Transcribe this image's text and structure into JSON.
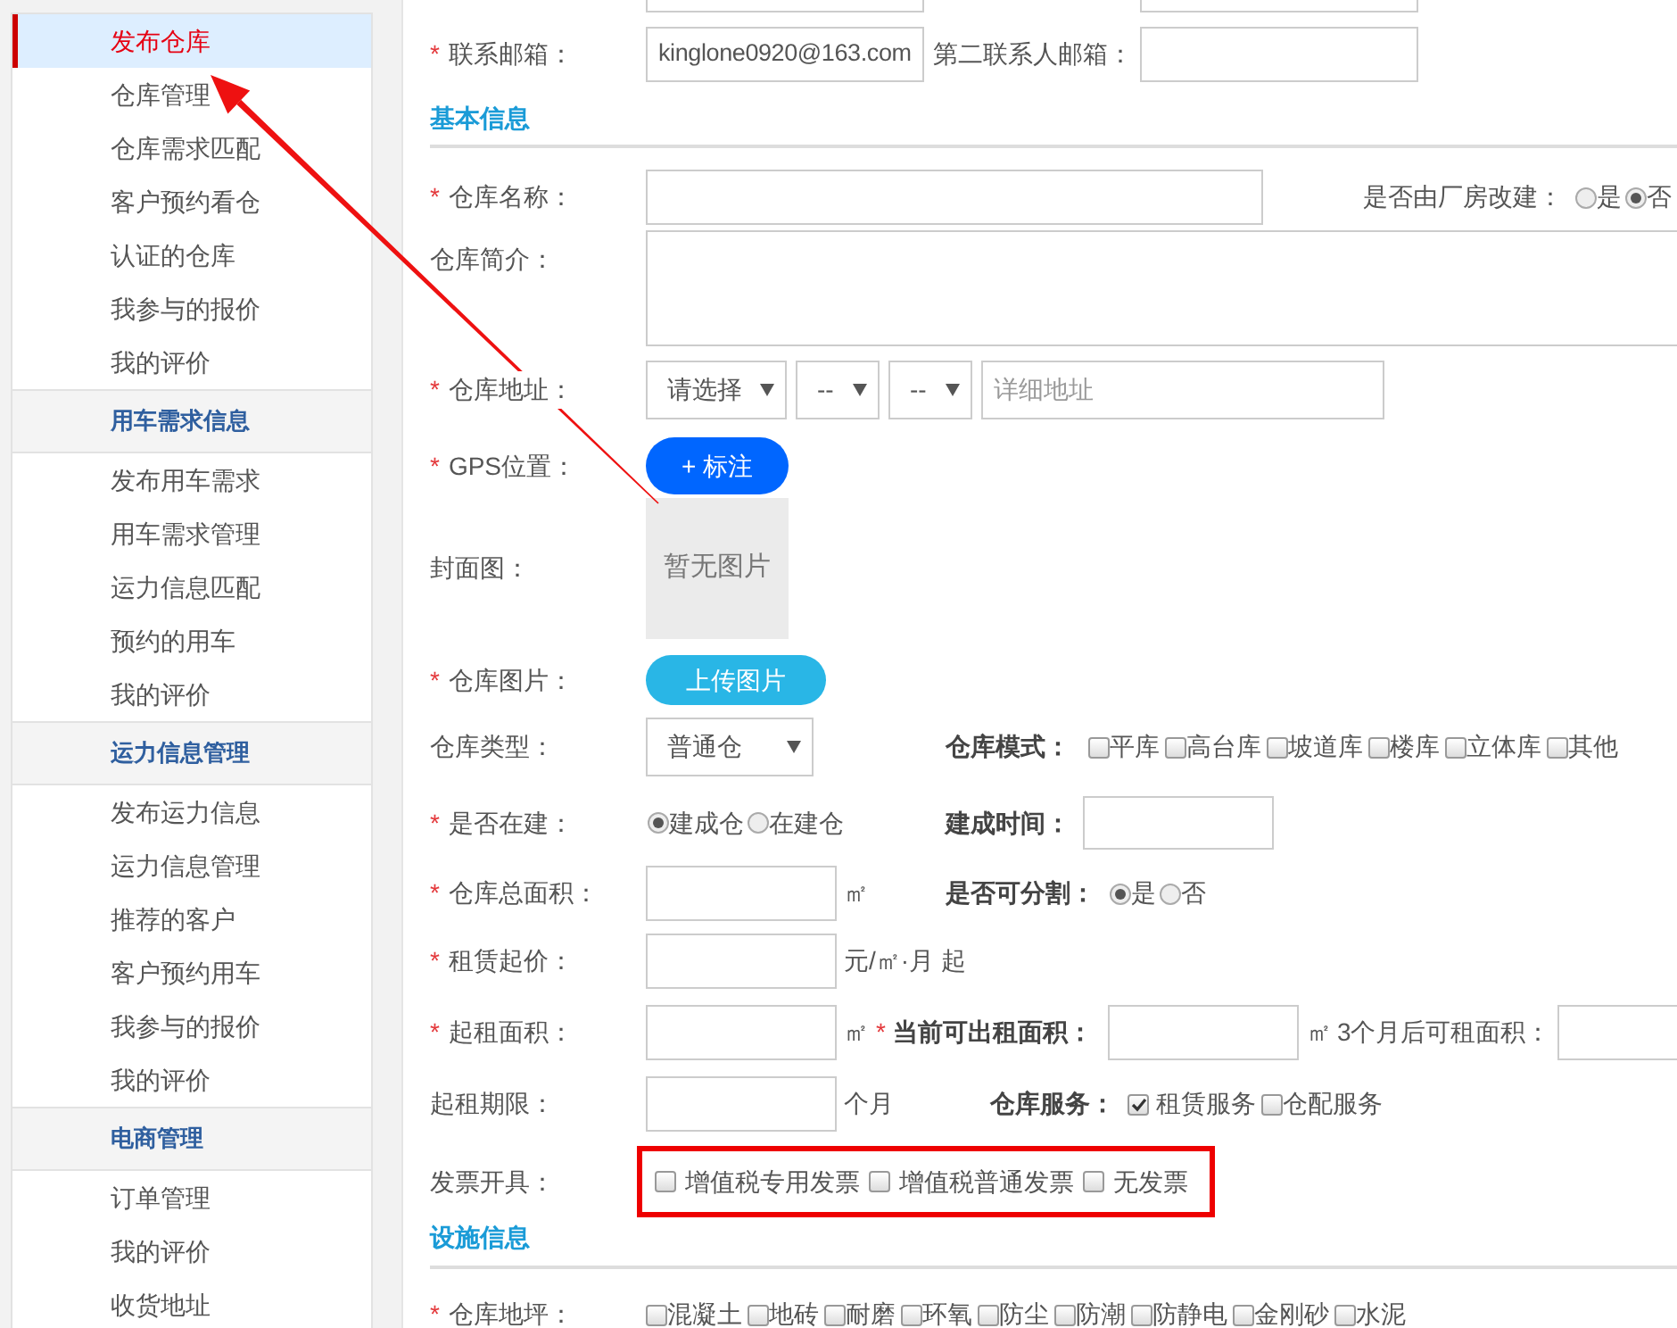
{
  "sidebar": {
    "sections": [
      {
        "items": [
          {
            "label": "发布仓库",
            "selected": true
          },
          {
            "label": "仓库管理",
            "selected": false
          },
          {
            "label": "仓库需求匹配",
            "selected": false
          },
          {
            "label": "客户预约看仓",
            "selected": false
          },
          {
            "label": "认证的仓库",
            "selected": false
          },
          {
            "label": "我参与的报价",
            "selected": false
          },
          {
            "label": "我的评价",
            "selected": false
          }
        ]
      },
      {
        "title": "用车需求信息",
        "items": [
          {
            "label": "发布用车需求",
            "selected": false
          },
          {
            "label": "用车需求管理",
            "selected": false
          },
          {
            "label": "运力信息匹配",
            "selected": false
          },
          {
            "label": "预约的用车",
            "selected": false
          },
          {
            "label": "我的评价",
            "selected": false
          }
        ]
      },
      {
        "title": "运力信息管理",
        "items": [
          {
            "label": "发布运力信息",
            "selected": false
          },
          {
            "label": "运力信息管理",
            "selected": false
          },
          {
            "label": "推荐的客户",
            "selected": false
          },
          {
            "label": "客户预约用车",
            "selected": false
          },
          {
            "label": "我参与的报价",
            "selected": false
          },
          {
            "label": "我的评价",
            "selected": false
          }
        ]
      },
      {
        "title": "电商管理",
        "items": [
          {
            "label": "订单管理",
            "selected": false
          },
          {
            "label": "我的评价",
            "selected": false
          },
          {
            "label": "收货地址",
            "selected": false
          }
        ]
      }
    ]
  },
  "form": {
    "email": {
      "mark": "*",
      "label": "联系邮箱：",
      "value": "kinglone0920@163.com"
    },
    "second_email": {
      "label": "第二联系人邮箱："
    },
    "basic_section": "基本信息",
    "warehouse_name": {
      "mark": "*",
      "label": "仓库名称："
    },
    "converted": {
      "label": "是否由厂房改建：",
      "options": [
        {
          "label": "是",
          "selected": false
        },
        {
          "label": "否",
          "selected": true
        }
      ]
    },
    "intro": {
      "label": "仓库简介："
    },
    "address": {
      "mark": "*",
      "label": "仓库地址：",
      "selects": [
        "请选择",
        "--",
        "--"
      ],
      "detail_placeholder": "详细地址"
    },
    "gps": {
      "mark": "*",
      "label": "GPS位置：",
      "button": "+ 标注"
    },
    "cover": {
      "label": "封面图：",
      "empty_text": "暂无图片"
    },
    "photos": {
      "mark": "*",
      "label": "仓库图片：",
      "button": "上传图片"
    },
    "type": {
      "label": "仓库类型：",
      "value": "普通仓"
    },
    "mode": {
      "label": "仓库模式：",
      "options": [
        {
          "label": "平库",
          "checked": false
        },
        {
          "label": "高台库",
          "checked": false
        },
        {
          "label": "坡道库",
          "checked": false
        },
        {
          "label": "楼库",
          "checked": false
        },
        {
          "label": "立体库",
          "checked": false
        },
        {
          "label": "其他",
          "checked": false
        }
      ]
    },
    "under_construction": {
      "mark": "*",
      "label": "是否在建：",
      "options": [
        {
          "label": "建成仓",
          "selected": true
        },
        {
          "label": "在建仓",
          "selected": false
        }
      ]
    },
    "built_time": {
      "label": "建成时间："
    },
    "total_area": {
      "mark": "*",
      "label": "仓库总面积：",
      "unit": "㎡"
    },
    "divisible": {
      "label": "是否可分割：",
      "options": [
        {
          "label": "是",
          "selected": true
        },
        {
          "label": "否",
          "selected": false
        }
      ]
    },
    "start_price": {
      "mark": "*",
      "label": "租赁起价：",
      "unit": "元/㎡·月 起"
    },
    "min_area": {
      "mark": "*",
      "label": "起租面积：",
      "unit": "㎡"
    },
    "current_area": {
      "mark": "*",
      "label": "当前可出租面积：",
      "unit": "㎡"
    },
    "future_area": {
      "label": "3个月后可租面积："
    },
    "min_term": {
      "label": "起租期限：",
      "unit": "个月"
    },
    "services": {
      "label": "仓库服务：",
      "options": [
        {
          "label": "租赁服务",
          "checked": true
        },
        {
          "label": "仓配服务",
          "checked": false
        }
      ]
    },
    "invoice": {
      "label": "发票开具：",
      "highlighted": true,
      "options": [
        {
          "label": "增值税专用发票",
          "checked": false
        },
        {
          "label": "增值税普通发票",
          "checked": false
        },
        {
          "label": "无发票",
          "checked": false
        }
      ]
    },
    "facility_section": "设施信息",
    "floor": {
      "mark": "*",
      "label": "仓库地坪：",
      "options": [
        {
          "label": "混凝土",
          "checked": false
        },
        {
          "label": "地砖",
          "checked": false
        },
        {
          "label": "耐磨",
          "checked": false
        },
        {
          "label": "环氧",
          "checked": false
        },
        {
          "label": "防尘",
          "checked": false
        },
        {
          "label": "防潮",
          "checked": false
        },
        {
          "label": "防静电",
          "checked": false
        },
        {
          "label": "金刚砂",
          "checked": false
        },
        {
          "label": "水泥",
          "checked": false
        }
      ]
    }
  }
}
